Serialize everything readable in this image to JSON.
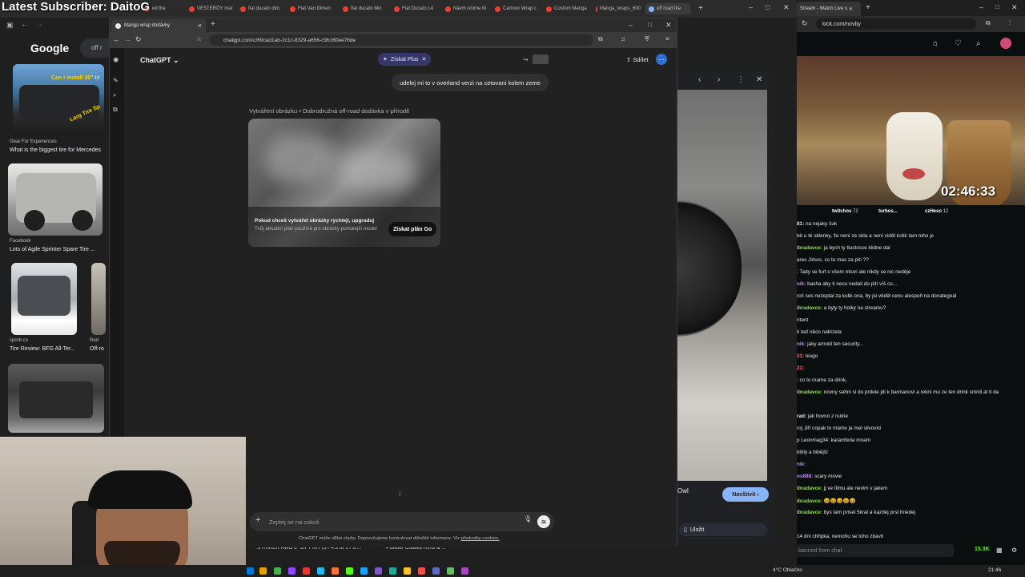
{
  "overlay": {
    "title": "Latest Subscriber: DaitoG"
  },
  "background_browser": {
    "tabs": [
      "ed the",
      "VESTERŐY mat",
      "fiat ducato dim",
      "Fiat Van Dimen",
      "flat ducato Mic",
      "Fiat Ducato L4",
      "Návrh Anime M",
      "Cartoon Wrap c",
      "Custom Manga",
      "Manga_wraps_600",
      "off road tire"
    ],
    "google_logo": "Google",
    "search_text": "off r",
    "results": [
      {
        "source": "Gear For Experiences",
        "title": "What is the biggest tire for Mercedes",
        "overlay_text": "Can I install 35\" tir",
        "overlay_text_2": "Larg Tire Sp"
      },
      {
        "source": "Facebook",
        "title": "Lots of Agile Sprinter Spare Tire ..."
      },
      {
        "source": "sprntr.co",
        "title": "Tire Review: BFG All-Ter..."
      },
      {
        "source": "Red",
        "title": "Off-ro"
      }
    ],
    "preview": {
      "caption": "Owl",
      "visit_label": "Navštívit",
      "save_label": "Uložit"
    },
    "bottom_strip": [
      "STRIKER AWD 2\" LIFT KIT (3 / 4.3 to 5 / 6....",
      "Powder Coated Rims & ..."
    ]
  },
  "chatgpt": {
    "tab_title": "Manga wrap dodávky",
    "url": "chatgpt.com/c/69cad1ab-2c1c-8329-a656-c9b160ee76de",
    "model_label": "ChatGPT",
    "plus_label": "Získat Plus",
    "share_label": "Sdílet",
    "user_message": "udelej mi to v overland verzi na cetovani kolem zeme",
    "image_gen_label": "Vytváření obrázku • Dobrodružná off-road dodávka v přírodě",
    "upsell_title": "Pokud chceš vytvářet obrázky rychleji, upgraduj",
    "upsell_sub": "Tvůj aktuální plán používá pro obrázky pomalejší model",
    "get_go_label": "Získat plán Go",
    "composer_placeholder": "Zeptej se na cokoli",
    "disclaimer": "ChatGPT může dělat chyby. Doporučujeme kontrolovat důležité informace. Viz",
    "disclaimer_link": "předvolby cookies."
  },
  "kick": {
    "tab_title": "Stream - Watch Live o",
    "url": "kick.com/novby",
    "timer": "02:46:33",
    "gifters": [
      {
        "name": "twitchos",
        "count": "72"
      },
      {
        "name": "turbos...",
        "count": ""
      },
      {
        "name": "czHeso",
        "count": "12"
      }
    ],
    "chat": [
      {
        "user": "81:",
        "text": "na nejaky šuk",
        "color": "#e6e6e6"
      },
      {
        "user": "",
        "text": "bě u té sklenky, že není ze skla a není vidět kolik tam toho je",
        "color": "#e6e6e6"
      },
      {
        "user": "ibradavce:",
        "text": "ja bych ty tlustosce klidne dal",
        "color": "#8ee24b"
      },
      {
        "user": "",
        "text": "arec Jirkos, co to mas za pití ??",
        "color": "#e6e6e6"
      },
      {
        "user": "",
        "text": ": Tady se furt o všem mluví ale nikdy se nic neděje",
        "color": "#e6e6e6"
      },
      {
        "user": "nik:",
        "text": "bacha aby ti neco nedali do pití víš co...",
        "color": "#c084fc"
      },
      {
        "user": "",
        "text": "roč ses nezeptal za kolik ona, by jsi věděl cenu alespoň na donategoal",
        "color": "#e6e6e6"
      },
      {
        "user": "ibradavce:",
        "text": "a byly ty holky na streamu?",
        "color": "#8ee24b"
      },
      {
        "user": "",
        "text": "ntent",
        "color": "#e6e6e6"
      },
      {
        "user": "",
        "text": "ti teď něco nabízela",
        "color": "#e6e6e6"
      },
      {
        "user": "nik:",
        "text": "jaky arnold ten security...",
        "color": "#c084fc"
      },
      {
        "user": "21:",
        "text": "lesgo",
        "color": "#ff6b6b"
      },
      {
        "user": "21:",
        "text": "",
        "color": "#ff6b6b"
      },
      {
        "user": "",
        "text": ": co to mame za drink,",
        "color": "#e6e6e6"
      },
      {
        "user": "ibradavce:",
        "text": "novny sahni si do prdele jdi k barmanovi a rekni mu ze ten drink smrdi at ti da",
        "color": "#8ee24b"
      },
      {
        "user": "",
        "text": "",
        "color": "#e6e6e6"
      },
      {
        "user": "rad:",
        "text": "jak hovno z nutrie",
        "color": "#e6e6e6"
      },
      {
        "user": "",
        "text": "roj Jiří copak to máme ja mel slivovici",
        "color": "#e6e6e6"
      },
      {
        "user": "",
        "text": "p Leonmag34: karambola mnam",
        "color": "#9a9a9a"
      },
      {
        "user": "",
        "text": "biblý a bibější",
        "color": "#e6e6e6"
      },
      {
        "user": "nik:",
        "text": "",
        "color": "#c084fc"
      },
      {
        "user": "os888:",
        "text": "scary movie",
        "color": "#c084fc"
      },
      {
        "user": "ibradavce:",
        "text": "jj ve filmu ale nevim v jakem",
        "color": "#8ee24b"
      },
      {
        "user": "ibradavce:",
        "text": "😆😆😆😆😆",
        "color": "#8ee24b"
      },
      {
        "user": "ibradavce:",
        "text": "bys tam prisel 5krat a kazdej prst hnedej",
        "color": "#8ee24b"
      },
      {
        "user": "",
        "text": "",
        "color": "#e6e6e6"
      },
      {
        "user": "",
        "text": "14 dní chřipka, nemohu se toho zbavit",
        "color": "#e6e6e6"
      }
    ],
    "chat_placeholder": "banned from chat",
    "viewers": "15.3K"
  },
  "taskbar": {
    "weather": "4°C Oblačno",
    "time": "21:46"
  },
  "colors": {
    "accent_blue": "#8ab4f8",
    "kick_green": "#53fc18",
    "plus_purple": "#373669"
  }
}
